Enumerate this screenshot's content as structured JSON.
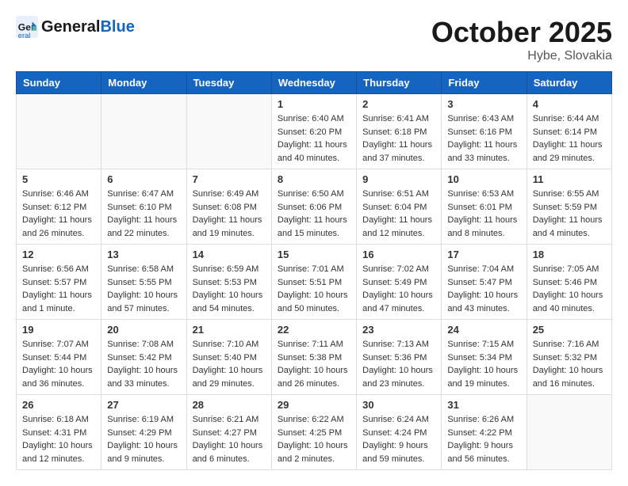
{
  "header": {
    "logo_general": "General",
    "logo_blue": "Blue",
    "month": "October 2025",
    "location": "Hybe, Slovakia"
  },
  "weekdays": [
    "Sunday",
    "Monday",
    "Tuesday",
    "Wednesday",
    "Thursday",
    "Friday",
    "Saturday"
  ],
  "weeks": [
    [
      {
        "day": "",
        "info": ""
      },
      {
        "day": "",
        "info": ""
      },
      {
        "day": "",
        "info": ""
      },
      {
        "day": "1",
        "info": "Sunrise: 6:40 AM\nSunset: 6:20 PM\nDaylight: 11 hours\nand 40 minutes."
      },
      {
        "day": "2",
        "info": "Sunrise: 6:41 AM\nSunset: 6:18 PM\nDaylight: 11 hours\nand 37 minutes."
      },
      {
        "day": "3",
        "info": "Sunrise: 6:43 AM\nSunset: 6:16 PM\nDaylight: 11 hours\nand 33 minutes."
      },
      {
        "day": "4",
        "info": "Sunrise: 6:44 AM\nSunset: 6:14 PM\nDaylight: 11 hours\nand 29 minutes."
      }
    ],
    [
      {
        "day": "5",
        "info": "Sunrise: 6:46 AM\nSunset: 6:12 PM\nDaylight: 11 hours\nand 26 minutes."
      },
      {
        "day": "6",
        "info": "Sunrise: 6:47 AM\nSunset: 6:10 PM\nDaylight: 11 hours\nand 22 minutes."
      },
      {
        "day": "7",
        "info": "Sunrise: 6:49 AM\nSunset: 6:08 PM\nDaylight: 11 hours\nand 19 minutes."
      },
      {
        "day": "8",
        "info": "Sunrise: 6:50 AM\nSunset: 6:06 PM\nDaylight: 11 hours\nand 15 minutes."
      },
      {
        "day": "9",
        "info": "Sunrise: 6:51 AM\nSunset: 6:04 PM\nDaylight: 11 hours\nand 12 minutes."
      },
      {
        "day": "10",
        "info": "Sunrise: 6:53 AM\nSunset: 6:01 PM\nDaylight: 11 hours\nand 8 minutes."
      },
      {
        "day": "11",
        "info": "Sunrise: 6:55 AM\nSunset: 5:59 PM\nDaylight: 11 hours\nand 4 minutes."
      }
    ],
    [
      {
        "day": "12",
        "info": "Sunrise: 6:56 AM\nSunset: 5:57 PM\nDaylight: 11 hours\nand 1 minute."
      },
      {
        "day": "13",
        "info": "Sunrise: 6:58 AM\nSunset: 5:55 PM\nDaylight: 10 hours\nand 57 minutes."
      },
      {
        "day": "14",
        "info": "Sunrise: 6:59 AM\nSunset: 5:53 PM\nDaylight: 10 hours\nand 54 minutes."
      },
      {
        "day": "15",
        "info": "Sunrise: 7:01 AM\nSunset: 5:51 PM\nDaylight: 10 hours\nand 50 minutes."
      },
      {
        "day": "16",
        "info": "Sunrise: 7:02 AM\nSunset: 5:49 PM\nDaylight: 10 hours\nand 47 minutes."
      },
      {
        "day": "17",
        "info": "Sunrise: 7:04 AM\nSunset: 5:47 PM\nDaylight: 10 hours\nand 43 minutes."
      },
      {
        "day": "18",
        "info": "Sunrise: 7:05 AM\nSunset: 5:46 PM\nDaylight: 10 hours\nand 40 minutes."
      }
    ],
    [
      {
        "day": "19",
        "info": "Sunrise: 7:07 AM\nSunset: 5:44 PM\nDaylight: 10 hours\nand 36 minutes."
      },
      {
        "day": "20",
        "info": "Sunrise: 7:08 AM\nSunset: 5:42 PM\nDaylight: 10 hours\nand 33 minutes."
      },
      {
        "day": "21",
        "info": "Sunrise: 7:10 AM\nSunset: 5:40 PM\nDaylight: 10 hours\nand 29 minutes."
      },
      {
        "day": "22",
        "info": "Sunrise: 7:11 AM\nSunset: 5:38 PM\nDaylight: 10 hours\nand 26 minutes."
      },
      {
        "day": "23",
        "info": "Sunrise: 7:13 AM\nSunset: 5:36 PM\nDaylight: 10 hours\nand 23 minutes."
      },
      {
        "day": "24",
        "info": "Sunrise: 7:15 AM\nSunset: 5:34 PM\nDaylight: 10 hours\nand 19 minutes."
      },
      {
        "day": "25",
        "info": "Sunrise: 7:16 AM\nSunset: 5:32 PM\nDaylight: 10 hours\nand 16 minutes."
      }
    ],
    [
      {
        "day": "26",
        "info": "Sunrise: 6:18 AM\nSunset: 4:31 PM\nDaylight: 10 hours\nand 12 minutes."
      },
      {
        "day": "27",
        "info": "Sunrise: 6:19 AM\nSunset: 4:29 PM\nDaylight: 10 hours\nand 9 minutes."
      },
      {
        "day": "28",
        "info": "Sunrise: 6:21 AM\nSunset: 4:27 PM\nDaylight: 10 hours\nand 6 minutes."
      },
      {
        "day": "29",
        "info": "Sunrise: 6:22 AM\nSunset: 4:25 PM\nDaylight: 10 hours\nand 2 minutes."
      },
      {
        "day": "30",
        "info": "Sunrise: 6:24 AM\nSunset: 4:24 PM\nDaylight: 9 hours\nand 59 minutes."
      },
      {
        "day": "31",
        "info": "Sunrise: 6:26 AM\nSunset: 4:22 PM\nDaylight: 9 hours\nand 56 minutes."
      },
      {
        "day": "",
        "info": ""
      }
    ]
  ]
}
